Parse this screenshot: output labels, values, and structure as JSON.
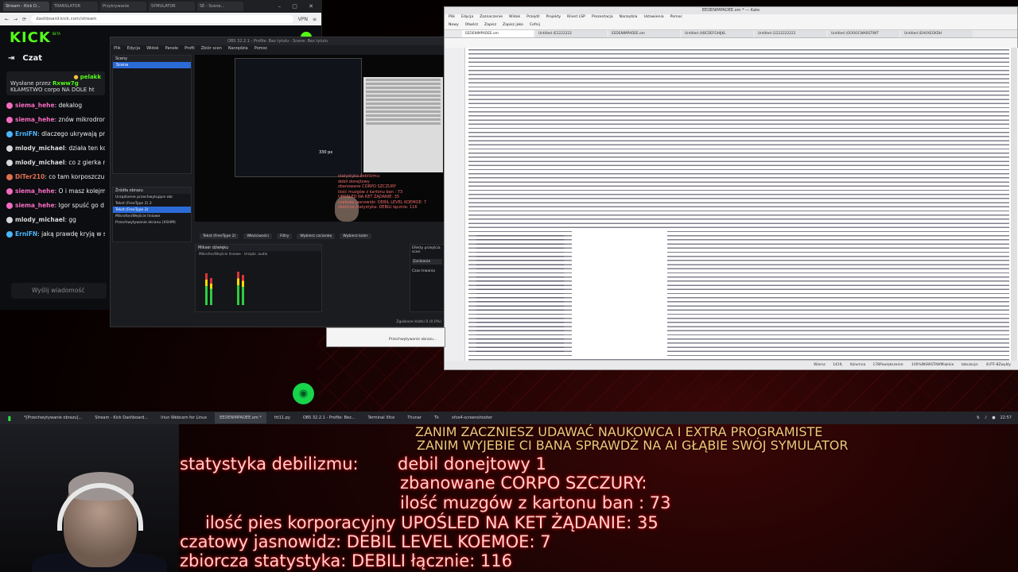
{
  "browser": {
    "tabs": [
      "Stream - Kick D...",
      "TRANSLATOR",
      "Przykrywanie",
      "SYMULATOR",
      "SE - Scene..."
    ],
    "url": "dashboard.kick.com/stream",
    "extra_label": "VPN"
  },
  "kick": {
    "logo": "KICK",
    "beta": "BETA"
  },
  "chat": {
    "title": "Czat",
    "pinned_user": "pelakk",
    "pinned_sent_by": "Wysłane przez",
    "pinned_sender": "Rxww7g",
    "pinned_text": "KŁAMSTWO corpo NA DOLE ht",
    "messages": [
      {
        "user": "siema_hehe",
        "text": "dekalog",
        "color": "#f36bc0"
      },
      {
        "user": "siema_hehe",
        "text": "znów mikrodron",
        "color": "#f36bc0"
      },
      {
        "user": "ErniFN",
        "text": "dlaczego ukrywają praw",
        "color": "#4ab8ff"
      },
      {
        "user": "mlody_michael",
        "text": "działa ten kod?",
        "color": "#d8d8d8"
      },
      {
        "user": "mlody_michael",
        "text": "co z gierka na r",
        "color": "#d8d8d8"
      },
      {
        "user": "DiTer210",
        "text": "co tam korposzczu",
        "color": "#e07050"
      },
      {
        "user": "siema_hehe",
        "text": "O i masz kolejm",
        "color": "#f36bc0"
      },
      {
        "user": "siema_hehe",
        "text": "Igor spuść go d",
        "color": "#f36bc0"
      },
      {
        "user": "mlody_michael",
        "text": "gg",
        "color": "#d8d8d8"
      },
      {
        "user": "ErniFN",
        "text": "jaką prawdę kryją w stre",
        "color": "#4ab8ff"
      }
    ],
    "input_placeholder": "Wyślij wiadomość"
  },
  "obs": {
    "title": "OBS 32.2.1 - Profile: Bez tytułu - Scene: Bez tytułu",
    "menu": [
      "Plik",
      "Edycja",
      "Widok",
      "Panele",
      "Profil",
      "Zbiór scen",
      "Narzędzia",
      "Pomoc"
    ],
    "scenes_header": "Sceny",
    "scene": "Scena",
    "sources_header": "Źródła obrazu",
    "sources": [
      "Urządzenie przechwytujące obr",
      "Tekst (FreeType 2) 2",
      "Tekst (FreeType 2)",
      "Mikrofon/Wejście liniowe",
      "Przechwytywanie ekranu (XSHM)"
    ],
    "toolbar": [
      "Tekst (FreeType 2)",
      "Właściwości",
      "Filtry",
      "Wybierz czcionkę",
      "Wybierz kolor"
    ],
    "mixer_header": "Mikser dźwięku",
    "mixer_channels": [
      "Mikrofon/Wejście liniowe",
      "Urządz. audio"
    ],
    "transitions_header": "Efekty przejścia scen",
    "transitions_value": "Zanikanie",
    "transitions_duration": "Czas trwania",
    "status": "Zgubione klatki 0 (0.0%)",
    "preview_stats": [
      "statystyka debilizmu:",
      "debil donejtowy",
      "zbanowane CORPO SZCZURY",
      "ilość muzgów z kartonu ban : 73",
      "UPOŚLED NA KET ŻĄDANIE: 35",
      "czatowy jasnowidz: DEBIL LEVEL KOEMOE: 7",
      "zbiorcza statystyka: DEBILI łącznie: 116"
    ],
    "preview_badge": "330 px"
  },
  "kate": {
    "title": "EEDENIMPADEE.om * — Kate",
    "menu": [
      "Plik",
      "Edycja",
      "Zaznaczenie",
      "Widok",
      "Przejdź",
      "Projekty",
      "Klient LSP",
      "Prezentacja",
      "Narzędzia",
      "Ustawienia",
      "Pomoc"
    ],
    "tools": [
      "Nowy",
      "Otwórz",
      "Zapisz",
      "Zapisz jako",
      "Cofnij"
    ],
    "tabs": [
      "EEDENIMPADEE.om",
      "Untitled (E2222222",
      "EEDENIMPADEE.om",
      "Untitled (ABCDEFGHIJKL",
      "Untitled (2222222222",
      "Untitled (OOOOCWARSTWIT",
      "Untitled (EHVXEOXDH"
    ],
    "status": [
      "Wiersz 1419, Kolumna 178",
      "Powiększenie: 100%",
      "INS",
      "WSTAW",
      "Miękkie tabulacje: 4",
      "UTF-8",
      "Zwykły"
    ]
  },
  "popup": {
    "text": "Przechwytywanie obrazu..."
  },
  "taskbar": {
    "items": [
      "*[Przechwytywanie obrazu]...",
      "Stream - Kick Dashboard...",
      "Iriun Webcam for Linux",
      "EEDENIMPADEE.om *",
      "ttt11.py",
      "OBS 32.2.1 - Profile: Bez...",
      "Terminal Xfce",
      "Thunar",
      "Tk",
      "xfce4-screenshooter"
    ],
    "clock": "22:57"
  },
  "overlay": {
    "header_line1": "ZANIM ZACZNIESZ UDAWAĆ NAUKOWCA I EXTRA PROGRAMISTE",
    "header_line2": "ZANIM WYJEBIE CI BANA SPRAWDŹ NA AI GŁĄBIE SWÓJ SYMULATOR",
    "stats_title": "statystyka debilizmu:",
    "stat_donejtowy": "debil donejtowy 1",
    "stat_corpo": "zbanowane CORPO SZCZURY:",
    "stat_karton": "ilość muzgów z kartonu ban : 73",
    "stat_pies": "ilość pies korporacyjny UPOŚLED NA KET ŻĄDANIE: 35",
    "stat_jasnowidz": "czatowy jasnowidz: DEBIL LEVEL KOEMOE: 7",
    "stat_zbiorcza": "zbiorcza statystyka: DEBILI łącznie: 116"
  }
}
